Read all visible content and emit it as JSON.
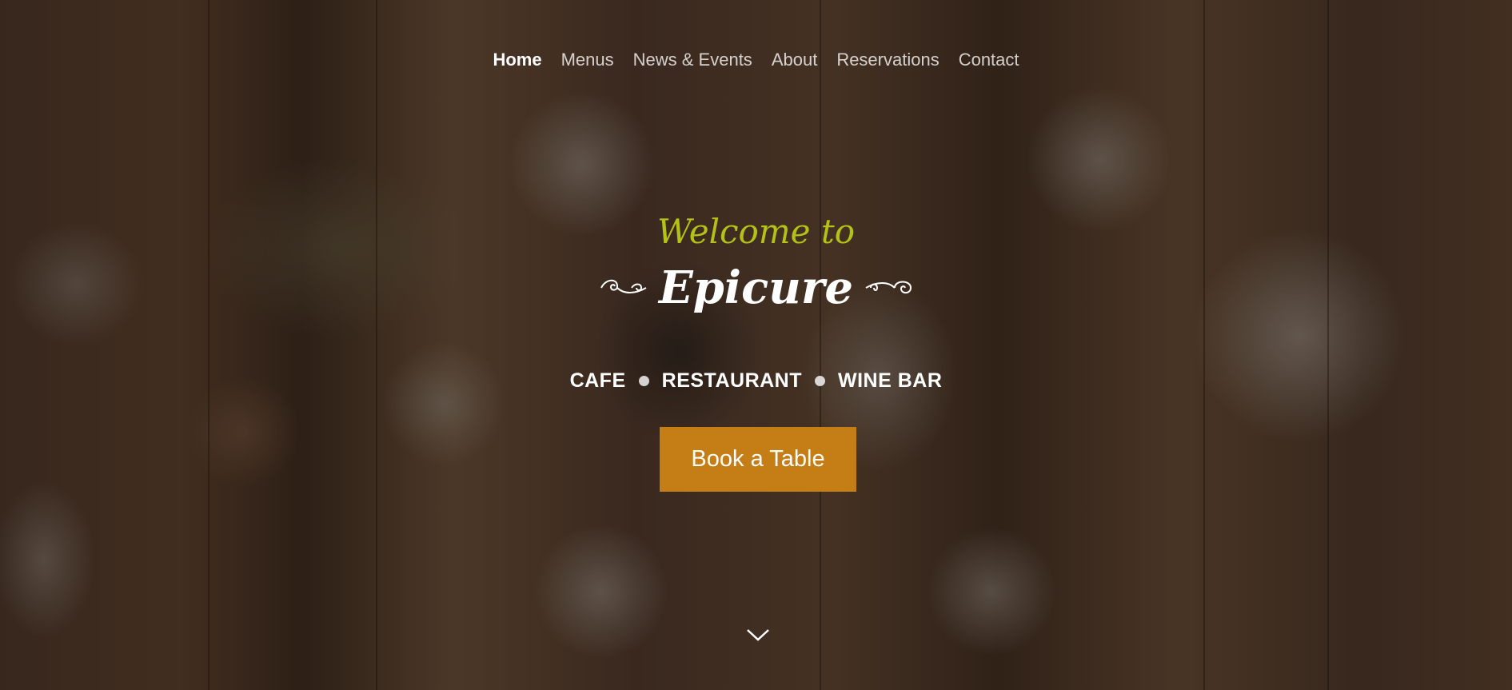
{
  "nav": {
    "items": [
      {
        "label": "Home",
        "active": true
      },
      {
        "label": "Menus",
        "active": false
      },
      {
        "label": "News & Events",
        "active": false
      },
      {
        "label": "About",
        "active": false
      },
      {
        "label": "Reservations",
        "active": false
      },
      {
        "label": "Contact",
        "active": false
      }
    ]
  },
  "hero": {
    "welcome": "Welcome to",
    "brand": "Epicure",
    "tagline": [
      "CAFE",
      "RESTAURANT",
      "WINE BAR"
    ],
    "cta_label": "Book a Table",
    "scroll_icon": "chevron-down-icon",
    "flourish_icon": "swirl-ornament-icon"
  },
  "colors": {
    "welcome": "#b3c214",
    "cta_background": "#c57d16",
    "text": "#ffffff"
  }
}
